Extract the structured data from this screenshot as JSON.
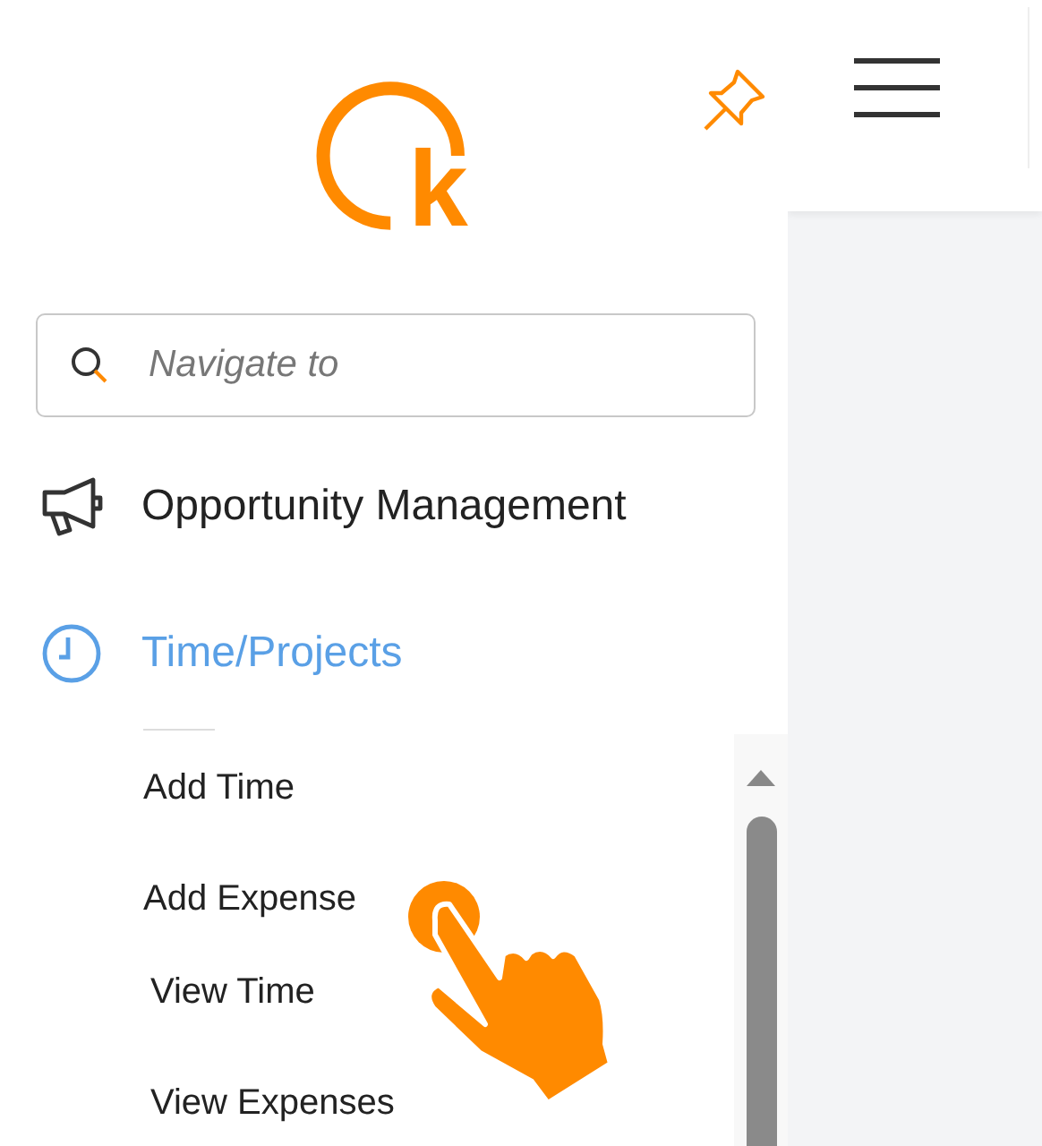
{
  "logo": {
    "letter": "k"
  },
  "search": {
    "placeholder": "Navigate to"
  },
  "nav": [
    {
      "label": "Opportunity Management",
      "selected": false
    },
    {
      "label": "Time/Projects",
      "selected": true,
      "children": [
        {
          "label": "Add Time"
        },
        {
          "label": "Add Expense"
        },
        {
          "label": "View Time"
        },
        {
          "label": "View Expenses"
        }
      ]
    }
  ]
}
